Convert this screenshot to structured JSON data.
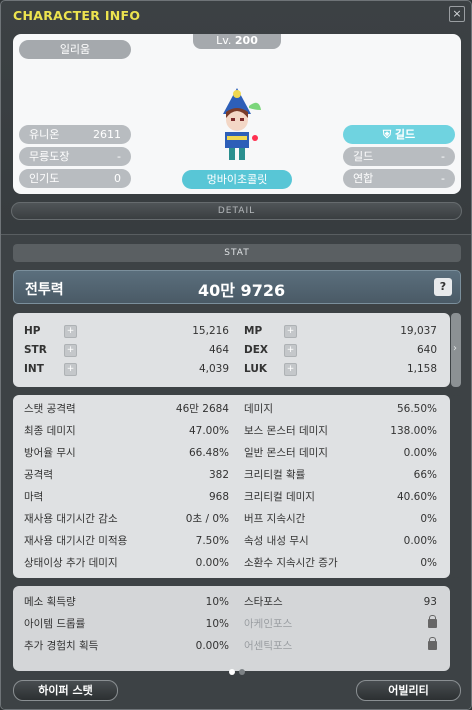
{
  "window": {
    "title": "CHARACTER INFO",
    "close": "×"
  },
  "character": {
    "level_prefix": "Lv.",
    "level": "200",
    "job": "일리움",
    "name": "멍바이초콜릿",
    "left_stats": [
      {
        "label": "유니온",
        "value": "2611"
      },
      {
        "label": "무릉도장",
        "value": "-"
      },
      {
        "label": "인기도",
        "value": "0"
      }
    ],
    "guild_button": "길드",
    "right_stats": [
      {
        "label": "길드",
        "value": "-"
      },
      {
        "label": "연합",
        "value": "-"
      }
    ]
  },
  "detail_label": "DETAIL",
  "stat": {
    "header": "STAT",
    "combat_power_label": "전투력",
    "combat_power_value": "40만 9726",
    "help": "?",
    "base": [
      {
        "k": "HP",
        "v": "15,216"
      },
      {
        "k": "MP",
        "v": "19,037"
      },
      {
        "k": "STR",
        "v": "464"
      },
      {
        "k": "DEX",
        "v": "640"
      },
      {
        "k": "INT",
        "v": "4,039"
      },
      {
        "k": "LUK",
        "v": "1,158"
      }
    ],
    "detail": [
      {
        "k": "스탯 공격력",
        "v": "46만 2684"
      },
      {
        "k": "데미지",
        "v": "56.50%"
      },
      {
        "k": "최종 데미지",
        "v": "47.00%"
      },
      {
        "k": "보스 몬스터 데미지",
        "v": "138.00%"
      },
      {
        "k": "방어율 무시",
        "v": "66.48%"
      },
      {
        "k": "일반 몬스터 데미지",
        "v": "0.00%"
      },
      {
        "k": "공격력",
        "v": "382"
      },
      {
        "k": "크리티컬 확률",
        "v": "66%"
      },
      {
        "k": "마력",
        "v": "968"
      },
      {
        "k": "크리티컬 데미지",
        "v": "40.60%"
      },
      {
        "k": "재사용 대기시간 감소",
        "v": "0초 / 0%"
      },
      {
        "k": "버프 지속시간",
        "v": "0%"
      },
      {
        "k": "재사용 대기시간 미적용",
        "v": "7.50%"
      },
      {
        "k": "속성 내성 무시",
        "v": "0.00%"
      },
      {
        "k": "상태이상 추가 데미지",
        "v": "0.00%"
      },
      {
        "k": "소환수 지속시간 증가",
        "v": "0%"
      }
    ],
    "misc": [
      {
        "k": "메소 획득량",
        "v": "10%"
      },
      {
        "k": "스타포스",
        "v": "93"
      },
      {
        "k": "아이템 드롭률",
        "v": "10%"
      },
      {
        "k": "아케인포스",
        "v": ""
      },
      {
        "k": "추가 경험치 획득",
        "v": "0.00%"
      },
      {
        "k": "어센틱포스",
        "v": ""
      }
    ]
  },
  "buttons": {
    "hyper_stat": "하이퍼 스탯",
    "ability": "어빌리티"
  },
  "colors": {
    "title": "#ece34f",
    "accent": "#58c6d6"
  }
}
